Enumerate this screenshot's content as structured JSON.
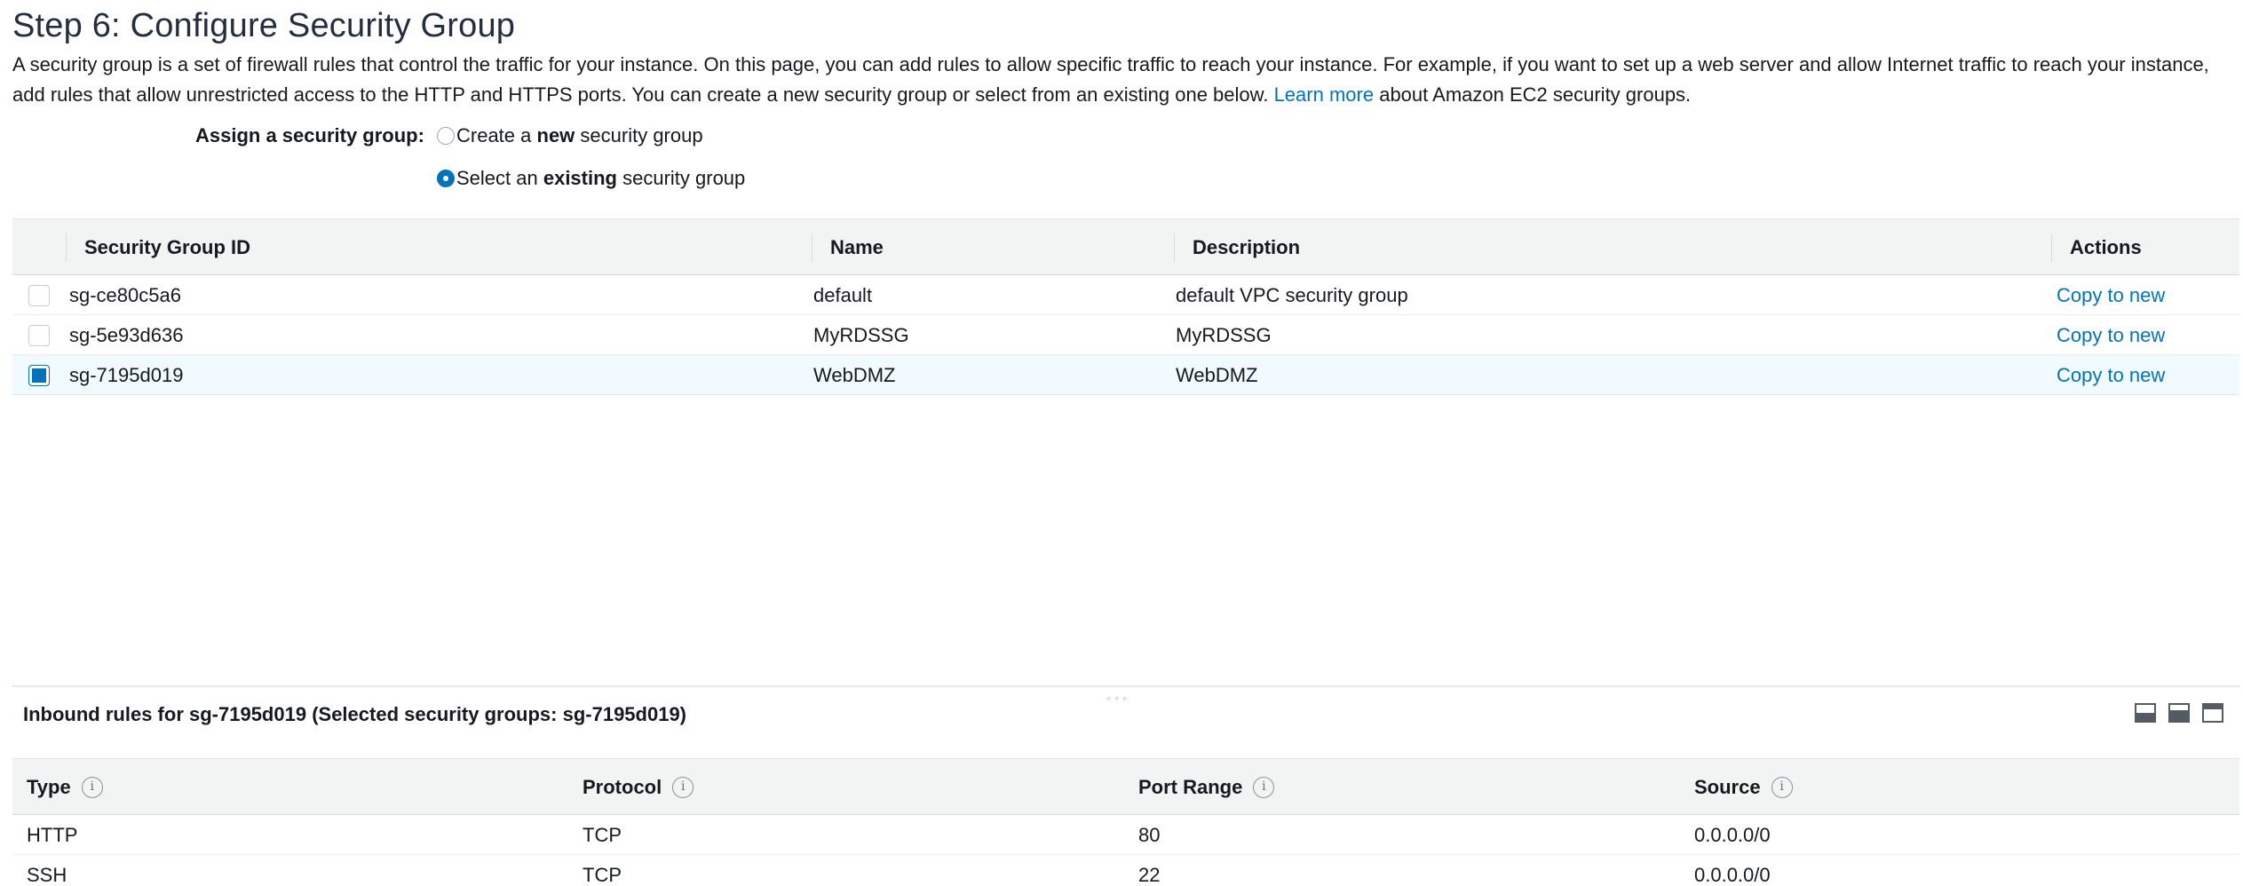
{
  "page": {
    "title": "Step 6: Configure Security Group",
    "intro_text": "A security group is a set of firewall rules that control the traffic for your instance. On this page, you can add rules to allow specific traffic to reach your instance. For example, if you want to set up a web server and allow Internet traffic to reach your instance, add rules that allow unrestricted access to the HTTP and HTTPS ports. You can create a new security group or select from an existing one below.",
    "learn_more": "Learn more",
    "intro_suffix": "about Amazon EC2 security groups."
  },
  "assign": {
    "label": "Assign a security group:",
    "option_new": {
      "prefix": "Create a ",
      "emphasis": "new",
      "suffix": " security group",
      "selected": false
    },
    "option_existing": {
      "prefix": "Select an ",
      "emphasis": "existing",
      "suffix": " security group",
      "selected": true
    }
  },
  "sg_table": {
    "headers": {
      "id": "Security Group ID",
      "name": "Name",
      "description": "Description",
      "actions": "Actions"
    },
    "rows": [
      {
        "id": "sg-ce80c5a6",
        "name": "default",
        "description": "default VPC security group",
        "action": "Copy to new",
        "selected": false
      },
      {
        "id": "sg-5e93d636",
        "name": "MyRDSSG",
        "description": "MyRDSSG",
        "action": "Copy to new",
        "selected": false
      },
      {
        "id": "sg-7195d019",
        "name": "WebDMZ",
        "description": "WebDMZ",
        "action": "Copy to new",
        "selected": true
      }
    ]
  },
  "inbound": {
    "title": "Inbound rules for sg-7195d019 (Selected security groups: sg-7195d019)",
    "headers": {
      "type": "Type",
      "protocol": "Protocol",
      "port_range": "Port Range",
      "source": "Source"
    },
    "info_glyph": "i",
    "rows": [
      {
        "type": "HTTP",
        "protocol": "TCP",
        "port_range": "80",
        "source": "0.0.0.0/0"
      },
      {
        "type": "SSH",
        "protocol": "TCP",
        "port_range": "22",
        "source": "0.0.0.0/0"
      }
    ]
  },
  "colors": {
    "link": "#0073bb",
    "header_bg": "#f2f3f3",
    "selected_row_bg": "#f1faff",
    "title": "#232f3e"
  }
}
